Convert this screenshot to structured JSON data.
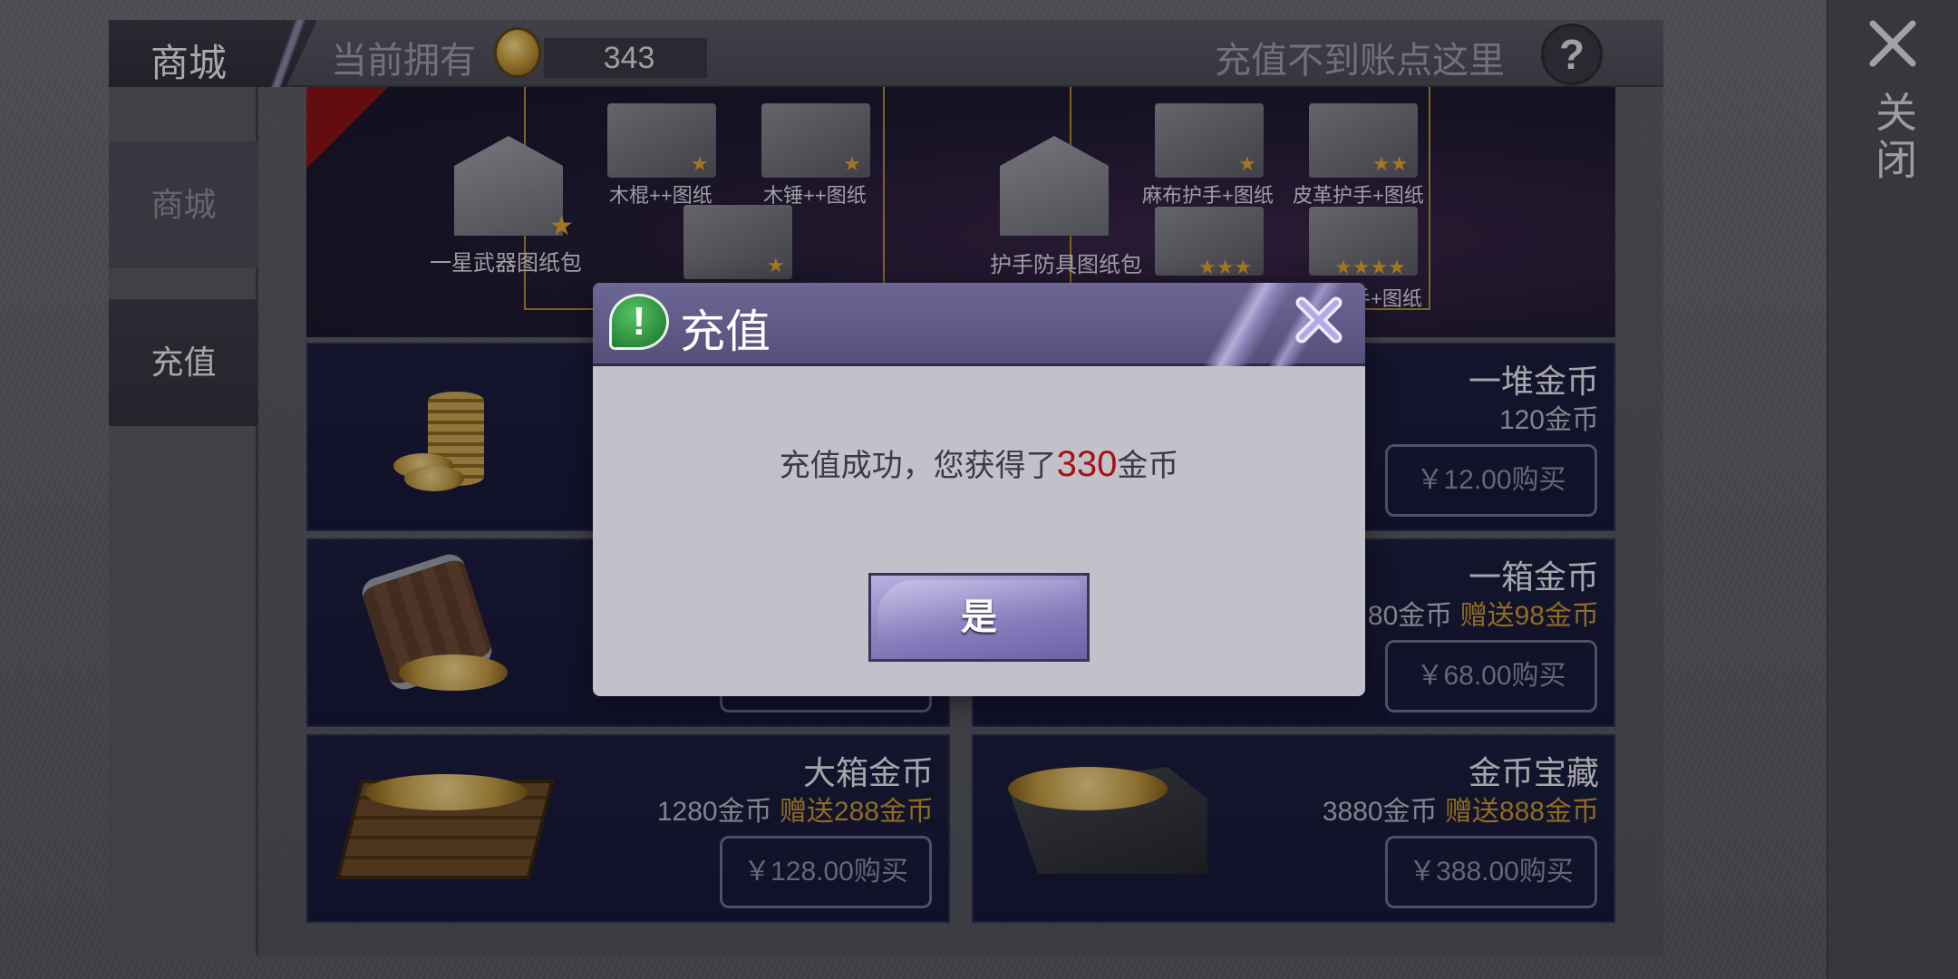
{
  "header": {
    "title": "商城",
    "owned_label": "当前拥有",
    "owned_value": "343",
    "help_text": "充值不到账点这里",
    "help_icon": "?"
  },
  "close_panel": {
    "label": "关闭"
  },
  "sidebar": {
    "items": [
      {
        "label": "商城",
        "active": false
      },
      {
        "label": "充值",
        "active": true
      }
    ]
  },
  "banner": {
    "bundle_a": {
      "name": "一星武器图纸包",
      "items": [
        {
          "label": "木棍++图纸",
          "stars": 1
        },
        {
          "label": "木锤++图纸",
          "stars": 1
        },
        {
          "label": "",
          "stars": 1
        }
      ]
    },
    "bundle_b": {
      "name": "护手防具图纸包",
      "items": [
        {
          "label": "麻布护手+图纸",
          "stars": 1
        },
        {
          "label": "皮革护手+图纸",
          "stars": 2
        },
        {
          "label": "",
          "stars": 3
        },
        {
          "label": "手+图纸",
          "stars": 4
        }
      ]
    }
  },
  "products": [
    {
      "title": "一堆金币",
      "amount": "120金币",
      "bonus": "",
      "price": "￥12.00购买"
    },
    {
      "title": "一箱金币",
      "amount": "80金币",
      "bonus": "赠送98金币",
      "price": "￥68.00购买"
    },
    {
      "title": "大箱金币",
      "amount": "1280金币",
      "bonus": "赠送288金币",
      "price": "￥128.00购买"
    },
    {
      "title": "金币宝藏",
      "amount": "3880金币",
      "bonus": "赠送888金币",
      "price": "￥388.00购买"
    },
    {
      "title": "",
      "amount": "",
      "bonus": "",
      "price": ""
    }
  ],
  "dialog": {
    "title": "充值",
    "message_prefix": "充值成功，您获得了",
    "message_amount": "330",
    "message_suffix": "金币",
    "confirm_label": "是"
  },
  "colors": {
    "accent_purple": "#6c6694",
    "bonus_gold": "#c9952d",
    "amount_red": "#a51212",
    "card_bg": "#1c1e3e"
  }
}
